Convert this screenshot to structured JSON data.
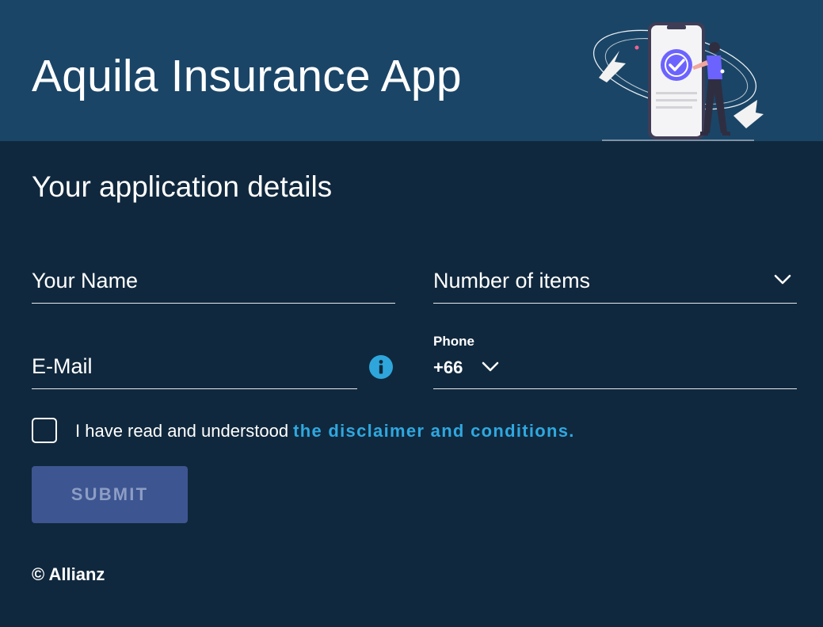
{
  "header": {
    "title": "Aquila Insurance App",
    "background": "#1a4567",
    "illustration": "phone-checkmark-woman-illustration"
  },
  "form": {
    "section_title": "Your application details",
    "name_field": {
      "placeholder": "Your Name"
    },
    "items_select": {
      "placeholder": "Number of items",
      "icon": "chevron-down-icon"
    },
    "email_field": {
      "placeholder": "E-Mail",
      "info_icon": "info-icon"
    },
    "phone_field": {
      "label": "Phone",
      "country_code": "+66",
      "icon": "chevron-down-icon"
    },
    "consent": {
      "text": "I have read and understood",
      "link_text": "the disclaimer and conditions.",
      "checked": false,
      "link_color": "#2fa8e0"
    },
    "submit": {
      "label": "SUBMIT",
      "background": "#3d5590",
      "disabled": true
    }
  },
  "footer": {
    "copyright": "© Allianz"
  },
  "colors": {
    "page_bg": "#10283d",
    "accent": "#2ea6db"
  }
}
